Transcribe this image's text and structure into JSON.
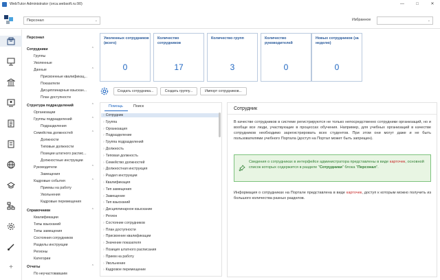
{
  "window": {
    "title": "WebTutor Administrator (orca.websoft.ru:90)"
  },
  "topbar": {
    "section_select": "Персонал",
    "favorites_label": "Избранное",
    "favorites_select": ""
  },
  "sidebar": {
    "title": "Персонал",
    "sections": [
      {
        "label": "Сотрудники",
        "items": [
          "Группы",
          "Уволенные"
        ]
      },
      {
        "label": "Данные",
        "items": [
          "Присвоенные квалификац...",
          "Показатели",
          "Дисциплинарные взыскан...",
          "План доступности"
        ]
      },
      {
        "label": "Структура подразделений",
        "items": [
          "Организации"
        ]
      },
      {
        "label": "Группы подразделений",
        "items": [
          "Подразделения"
        ]
      },
      {
        "label": "Семейства должностей",
        "items": [
          "Должности",
          "Типовые должности",
          "Позиции штатного распис...",
          "Должностные инструкции"
        ]
      },
      {
        "label": "Руководители",
        "items": [
          "Замещения"
        ]
      },
      {
        "label": "Кадровые события",
        "items": [
          "Приемы на работу",
          "Увольнения",
          "Кадровые перемещения"
        ]
      },
      {
        "label": "Справочники",
        "items": [
          "Квалификации",
          "Типы взысканий",
          "Типы замещения",
          "Состояния сотрудников",
          "Разделы инструкции",
          "Регионы",
          "Категории"
        ]
      },
      {
        "label": "Отчеты",
        "items": [
          "По неучастовавшим"
        ]
      }
    ]
  },
  "cards": [
    {
      "label": "Уволенных сотрудников (всего)",
      "value": "0"
    },
    {
      "label": "Количество сотрудников",
      "value": "17"
    },
    {
      "label": "Количество групп",
      "value": "3"
    },
    {
      "label": "Количество руководителей",
      "value": "0"
    },
    {
      "label": "Новых сотрудников (за неделю)",
      "value": "0"
    }
  ],
  "toolbar": {
    "create_employee": "Создать сотрудника...",
    "create_group": "Создать группу...",
    "import_employees": "Импорт сотрудников..."
  },
  "help_panel": {
    "tabs": [
      "Помощь",
      "Поиск"
    ],
    "items": [
      "Сотрудник",
      "Группа",
      "Организация",
      "Подразделение",
      "Группа подразделений",
      "Должность",
      "Типовая должность",
      "Семейство должностей",
      "Должностная инструкция",
      "Раздел инструкции",
      "Квалификация",
      "Тип замещения",
      "Замещение",
      "Тип взысканий",
      "Дисциплинарное взыскание",
      "Регион",
      "Состояние сотрудников",
      "План доступности",
      "Присвоение квалификации",
      "Значение показателя",
      "Позиция штатного расписания",
      "Прием на работу",
      "Увольнение",
      "Кадровое перемещение"
    ]
  },
  "article": {
    "title": "Сотрудник",
    "p1": "В качестве сотрудников в системе регистрируются не только непосредственно сотрудники организаций, но и вообще все люди, участвующие в процессах обучения. Например, для учебных организаций в качестве сотрудников необходимо зарегистрировать всех студентов. При этом они могут даже и не быть пользователями учебного Портала (доступ на Портал может быть запрещен).",
    "note_a": "Сведения о сотрудниках в интерфейсе администратора представлены в виде ",
    "note_link": "карточек",
    "note_b": ", основной список которых содержится в разделе \"",
    "note_b1": "Сотрудники",
    "note_b2": "\" блока \"",
    "note_b3": "Персонал",
    "note_b4": "\".",
    "p2_a": "Информация о сотрудниках на Портале представлена в виде ",
    "p2_link": "карточек",
    "p2_b": ", доступ к которым можно получить из большого количества разных разделов."
  },
  "colors": {
    "accent": "#1f66c1",
    "note_bg": "#e8f5e3",
    "note_text": "#2e7d32",
    "link": "#c62828"
  }
}
